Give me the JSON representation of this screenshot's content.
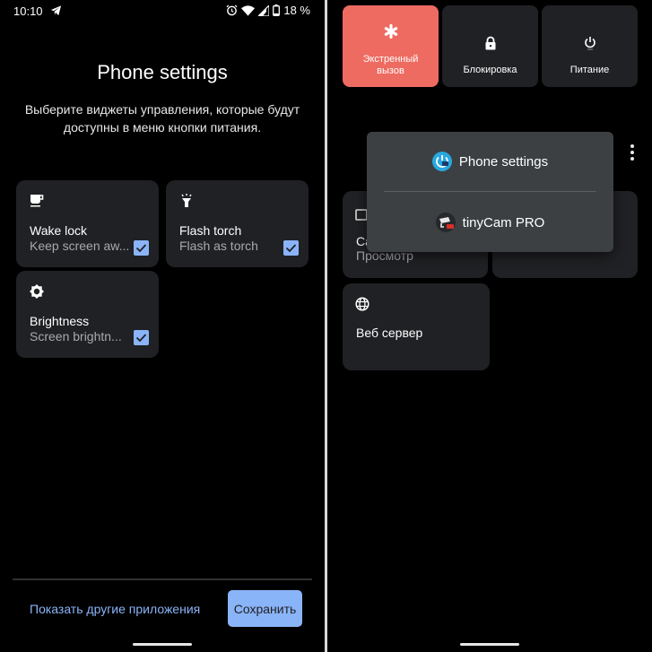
{
  "left": {
    "status_bar": {
      "time": "10:10",
      "battery": "18 %",
      "icons": [
        "telegram-icon",
        "alarm-icon",
        "wifi-icon",
        "signal-icon",
        "battery-icon"
      ]
    },
    "title": "Phone settings",
    "subtitle": "Выберите виджеты управления, которые будут доступны в меню кнопки питания.",
    "widgets": [
      {
        "name": "Wake lock",
        "desc": "Keep screen aw...",
        "icon": "coffee-cup-icon",
        "checked": true
      },
      {
        "name": "Flash torch",
        "desc": "Flash as torch",
        "icon": "flashlight-icon",
        "checked": true
      },
      {
        "name": "Brightness",
        "desc": "Screen brightn...",
        "icon": "brightness-icon",
        "checked": true
      }
    ],
    "footer": {
      "other_apps_label": "Показать другие приложения",
      "save_label": "Сохранить"
    },
    "colors": {
      "accent": "#8ab4f8",
      "tile": "#202124"
    }
  },
  "right": {
    "power_menu": [
      {
        "label_line1": "Экстренный",
        "label_line2": "вызов",
        "icon": "asterisk-icon",
        "color": "#ee6b61"
      },
      {
        "label_line1": "Блокировка",
        "icon": "lock-icon"
      },
      {
        "label_line1": "Питание",
        "icon": "power-icon"
      }
    ],
    "controls": [
      {
        "name_partial": "Ca",
        "desc": "Просмотр",
        "icon": "camera-icon"
      },
      {
        "name": "Веб сервер",
        "icon": "globe-icon"
      }
    ],
    "dropdown": [
      {
        "label": "Phone settings",
        "icon": "phone-settings-app-icon"
      },
      {
        "label": "tinyCam PRO",
        "icon": "tinycam-app-icon"
      }
    ]
  }
}
